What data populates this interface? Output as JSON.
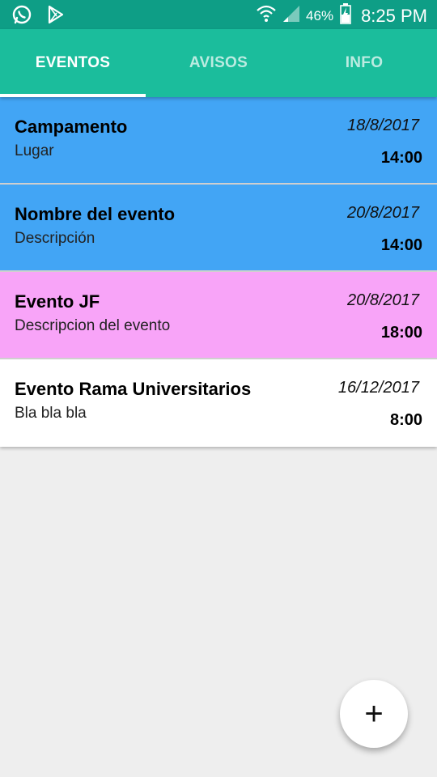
{
  "status_bar": {
    "battery": "46%",
    "time": "8:25 PM",
    "icons": [
      "whatsapp-icon",
      "play-store-icon",
      "wifi-icon",
      "signal-icon",
      "battery-charging-icon"
    ]
  },
  "tabs": [
    {
      "label": "EVENTOS",
      "selected": true
    },
    {
      "label": "AVISOS",
      "selected": false
    },
    {
      "label": "INFO",
      "selected": false
    }
  ],
  "colors": {
    "status_bar": "#0e9e86",
    "tab_bar": "#1bbd9c",
    "card_blue": "#42a5f5",
    "card_pink": "#f8a4f8",
    "card_white": "#ffffff",
    "background": "#eeeeee"
  },
  "events": [
    {
      "title": "Campamento",
      "description": "Lugar",
      "date": "18/8/2017",
      "time": "14:00",
      "color": "#42a5f5"
    },
    {
      "title": "Nombre del evento",
      "description": "Descripción",
      "date": "20/8/2017",
      "time": "14:00",
      "color": "#42a5f5"
    },
    {
      "title": "Evento JF",
      "description": "Descripcion del evento",
      "date": "20/8/2017",
      "time": "18:00",
      "color": "#f8a4f8"
    },
    {
      "title": "Evento Rama Universitarios",
      "description": "Bla bla bla",
      "date": "16/12/2017",
      "time": "8:00",
      "color": "#ffffff"
    }
  ],
  "fab": {
    "label": "+",
    "icon": "add-icon"
  }
}
